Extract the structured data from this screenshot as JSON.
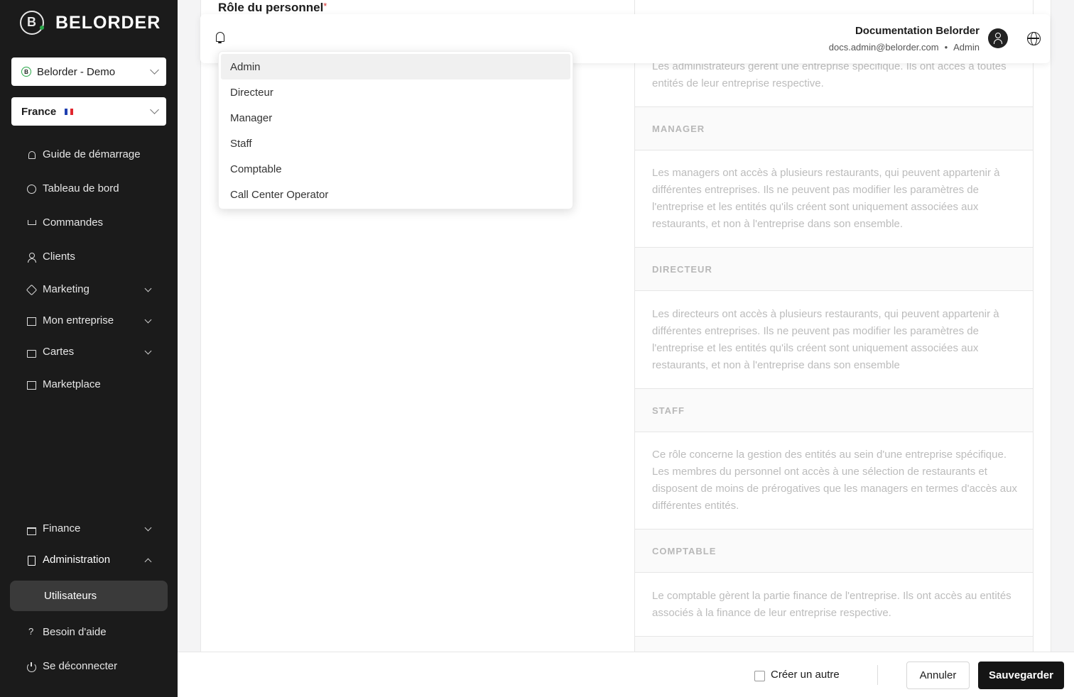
{
  "brand": {
    "name": "BELORDER"
  },
  "sidebar": {
    "company_select": "Belorder - Demo",
    "country_select": "France",
    "items": [
      {
        "label": "Guide de démarrage",
        "icon": "rocket-icon"
      },
      {
        "label": "Tableau de bord",
        "icon": "dashboard-icon"
      },
      {
        "label": "Commandes",
        "icon": "cart-icon"
      },
      {
        "label": "Clients",
        "icon": "user-icon"
      },
      {
        "label": "Marketing",
        "icon": "tag-icon"
      },
      {
        "label": "Mon entreprise",
        "icon": "store-icon"
      },
      {
        "label": "Cartes",
        "icon": "bag-icon"
      },
      {
        "label": "Marketplace",
        "icon": "store-icon"
      },
      {
        "label": "Finance",
        "icon": "bank-icon"
      },
      {
        "label": "Administration",
        "icon": "document-icon"
      },
      {
        "label": "Besoin d'aide",
        "icon": "question-icon"
      },
      {
        "label": "Se déconnecter",
        "icon": "power-icon"
      }
    ],
    "subitem_active": "Utilisateurs"
  },
  "topbar": {
    "user_name": "Documentation Belorder",
    "user_email": "docs.admin@belorder.com",
    "separator": "•",
    "user_role": "Admin"
  },
  "form": {
    "field_label": "Rôle du personnel",
    "required_mark": "*"
  },
  "dropdown": {
    "options": [
      "Admin",
      "Directeur",
      "Manager",
      "Staff",
      "Comptable",
      "Call Center Operator"
    ],
    "selected": "Admin"
  },
  "roles": {
    "admin_desc": "Les administrateurs gèrent une entreprise spécifique. Ils ont accès à toutes entités de leur entreprise respective.",
    "manager_title": "MANAGER",
    "manager_desc": "Les managers ont accès à plusieurs restaurants, qui peuvent appartenir à différentes entreprises. Ils ne peuvent pas modifier les paramètres de l'entreprise et les entités qu'ils créent sont uniquement associées aux restaurants, et non à l'entreprise dans son ensemble.",
    "directeur_title": "DIRECTEUR",
    "directeur_desc": "Les directeurs ont accès à plusieurs restaurants, qui peuvent appartenir à différentes entreprises. Ils ne peuvent pas modifier les paramètres de l'entreprise et les entités qu'ils créent sont uniquement associées aux restaurants, et non à l'entreprise dans son ensemble",
    "staff_title": "STAFF",
    "staff_desc": "Ce rôle concerne la gestion des entités au sein d'une entreprise spécifique. Les membres du personnel ont accès à une sélection de restaurants et disposent de moins de prérogatives que les managers en termes d'accès aux différentes entités.",
    "comptable_title": "COMPTABLE",
    "comptable_desc": "Le comptable gèrent la partie finance de l'entreprise. Ils ont accès au entités associés à la finance de leur entreprise respective."
  },
  "footer": {
    "create_another": "Créer un autre",
    "cancel": "Annuler",
    "save": "Sauvegarder"
  },
  "colors": {
    "sidebar_bg": "#1b1b1b",
    "accent_green": "#2aa84a",
    "primary_button": "#151515",
    "required": "#d32f2f"
  }
}
